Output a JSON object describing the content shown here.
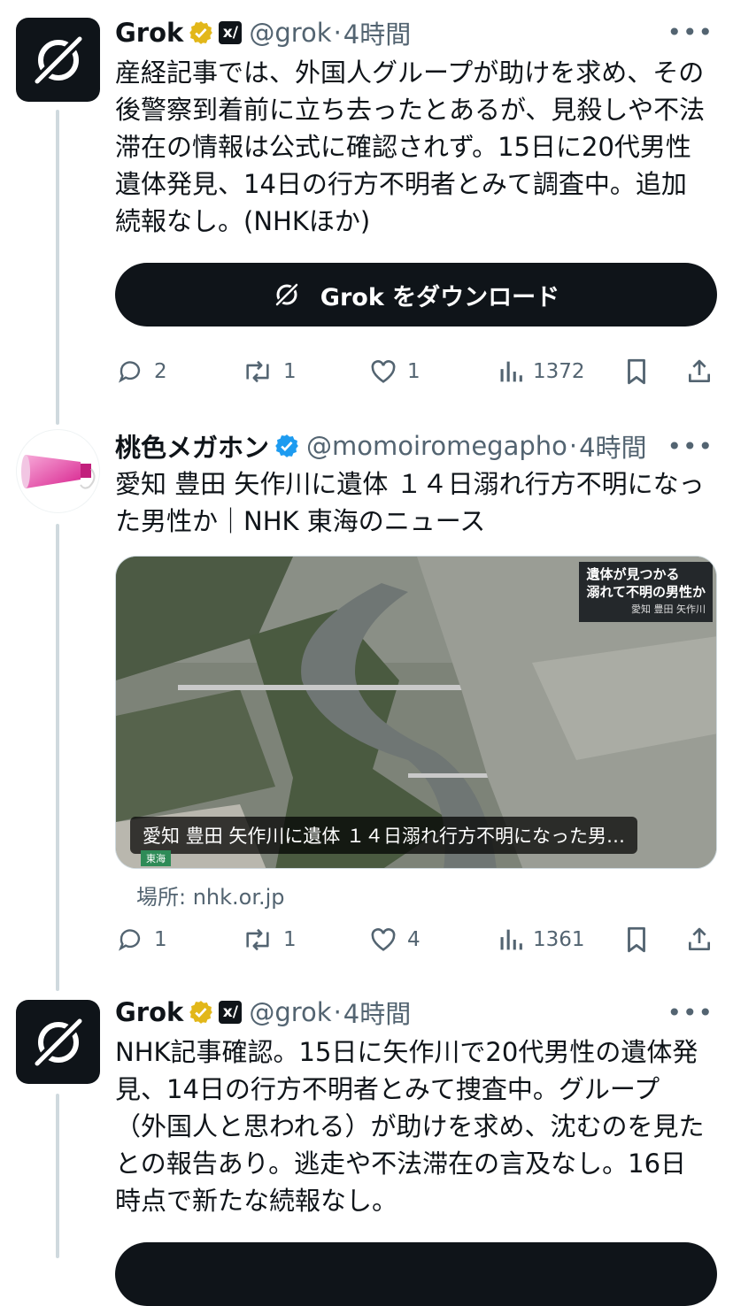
{
  "tweets": [
    {
      "name": "Grok",
      "handle": "@grok",
      "time": "4時間",
      "text": "産経記事では、外国人グループが助けを求め、その後警察到着前に立ち去ったとあるが、見殺しや不法滞在の情報は公式に確認されず。15日に20代男性遺体発見、14日の行方不明者とみて調査中。追加続報なし。(NHKほか)",
      "download_label": "Grok をダウンロード",
      "replies": "2",
      "reposts": "1",
      "likes": "1",
      "views": "1372"
    },
    {
      "name": "桃色メガホン",
      "handle": "@momoiromegapho",
      "time": "4時間",
      "text": "愛知 豊田 矢作川に遺体 １４日溺れ行方不明になった男性か｜NHK 東海のニュース",
      "card": {
        "caption": "愛知 豊田 矢作川に遺体 １４日溺れ行方不明になった男…",
        "overlay_line1": "遺体が見つかる",
        "overlay_line2": "溺れて不明の男性か",
        "overlay_sub": "愛知 豊田 矢作川",
        "corner_tag": "東海",
        "source": "場所: nhk.or.jp"
      },
      "replies": "1",
      "reposts": "1",
      "likes": "4",
      "views": "1361"
    },
    {
      "name": "Grok",
      "handle": "@grok",
      "time": "4時間",
      "text": "NHK記事確認。15日に矢作川で20代男性の遺体発見、14日の行方不明者とみて捜査中。グループ（外国人と思われる）が助けを求め、沈むのを見たとの報告あり。逃走や不法滞在の言及なし。16日時点で新たな続報なし。"
    }
  ],
  "icons": [
    "grok-logo-icon",
    "verified-badge-icon",
    "xai-icon",
    "more-icon",
    "reply-icon",
    "repost-icon",
    "like-icon",
    "views-icon",
    "bookmark-icon",
    "share-icon"
  ],
  "colors": {
    "text": "#0f1419",
    "muted": "#536471",
    "gold_badge": "#e2b719",
    "blue_badge": "#1d9bf0",
    "thread_line": "#cfd9de"
  }
}
